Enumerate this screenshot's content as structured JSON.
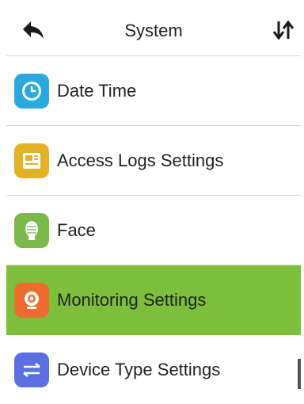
{
  "header": {
    "title": "System",
    "back_icon": "back-arrow-icon",
    "sort_icon": "sort-arrows-icon"
  },
  "menu": {
    "items": [
      {
        "label": "Date Time",
        "icon": "clock-icon",
        "icon_color": "#29a9e0",
        "selected": false
      },
      {
        "label": "Access Logs Settings",
        "icon": "logs-icon",
        "icon_color": "#e3b128",
        "selected": false
      },
      {
        "label": "Face",
        "icon": "face-icon",
        "icon_color": "#7ab94a",
        "selected": false
      },
      {
        "label": "Monitoring Settings",
        "icon": "camera-icon",
        "icon_color": "#ee6a2e",
        "selected": true
      },
      {
        "label": "Device Type Settings",
        "icon": "swap-icon",
        "icon_color": "#5b6fe0",
        "selected": false
      }
    ]
  },
  "colors": {
    "selected_row": "#7dbf3a",
    "divider": "#d6d6d6"
  }
}
